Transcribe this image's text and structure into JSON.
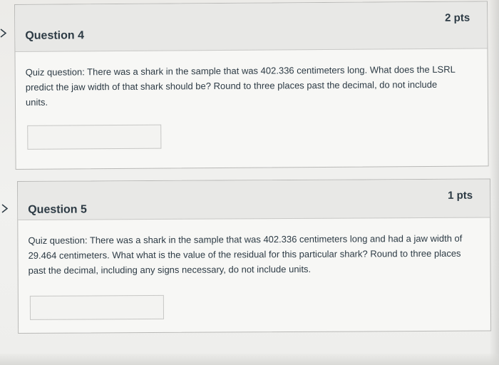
{
  "questions": [
    {
      "title": "Question 4",
      "points": "2 pts",
      "text": "Quiz question: There was a shark in the sample that was 402.336 centimeters long. What does the LSRL predict the jaw width of that shark should be? Round to three places past the decimal, do not include units.",
      "answer_value": "",
      "answer_placeholder": ""
    },
    {
      "title": "Question 5",
      "points": "1 pts",
      "text": "Quiz question: There was a shark in the sample that was 402.336 centimeters long and had a jaw width of 29.464 centimeters. What what is the value of the residual for this particular shark? Round to three places past the decimal, including any signs necessary, do not include units.",
      "answer_value": "",
      "answer_placeholder": ""
    }
  ],
  "icons": {
    "flag": "flag-icon"
  },
  "colors": {
    "text": "#2d3b45",
    "header_bg": "#e8e8e6",
    "card_bg": "#f7f7f5",
    "border": "#b8b8b6"
  }
}
